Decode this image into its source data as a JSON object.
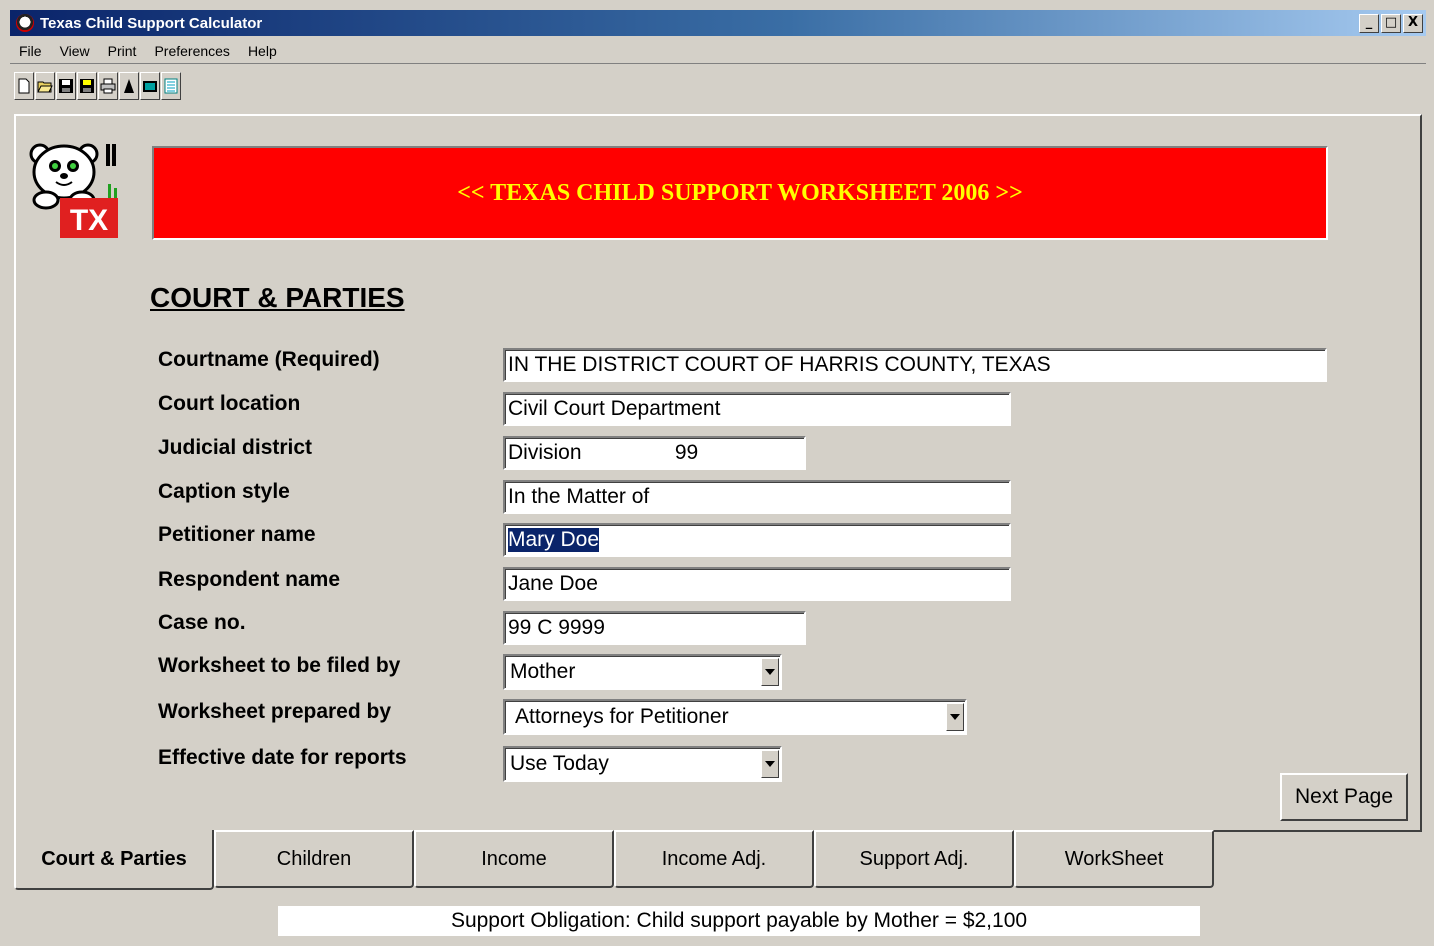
{
  "window": {
    "title": "Texas Child Support Calculator",
    "min_glyph": "_",
    "max_glyph": "□",
    "close_glyph": "X"
  },
  "menu": [
    "File",
    "View",
    "Print",
    "Preferences",
    "Help"
  ],
  "toolbar": [
    "new-file-icon",
    "open-folder-icon",
    "save-icon",
    "save-as-icon",
    "print-icon",
    "pointer-icon",
    "calculator-icon",
    "notepad-icon"
  ],
  "logo": {
    "badge": "TX"
  },
  "banner": {
    "text": "<< TEXAS CHILD SUPPORT WORKSHEET 2006 >>"
  },
  "section": {
    "title": "COURT & PARTIES"
  },
  "fields": {
    "courtname": {
      "label": "Courtname (Required)",
      "value": "IN THE DISTRICT COURT OF HARRIS COUNTY, TEXAS"
    },
    "court_location": {
      "label": "Court location",
      "value": "Civil Court Department"
    },
    "judicial_district": {
      "label": "Judicial district",
      "value": "Division                99"
    },
    "caption_style": {
      "label": "Caption style",
      "value": "In the Matter of"
    },
    "petitioner_name": {
      "label": "Petitioner name",
      "value": "Mary Doe"
    },
    "respondent_name": {
      "label": "Respondent name",
      "value": "Jane Doe"
    },
    "case_no": {
      "label": "Case no.",
      "value": "99 C 9999"
    },
    "filed_by": {
      "label": "Worksheet to be filed by",
      "value": "Mother"
    },
    "prepared_by": {
      "label": "Worksheet prepared by",
      "value": "Attorneys for  Petitioner"
    },
    "effective_date": {
      "label": "Effective date for reports",
      "value": "Use Today"
    }
  },
  "buttons": {
    "next_page": "Next Page"
  },
  "tabs": [
    "Court & Parties",
    "Children",
    "Income",
    "Income Adj.",
    "Support Adj.",
    "WorkSheet"
  ],
  "status": {
    "text": "Support Obligation:  Child support payable by Mother = $2,100"
  },
  "colors": {
    "banner_bg": "#ff0000",
    "banner_text": "#ffff00",
    "title_bar": "#0a246a",
    "selection": "#0a246a"
  }
}
